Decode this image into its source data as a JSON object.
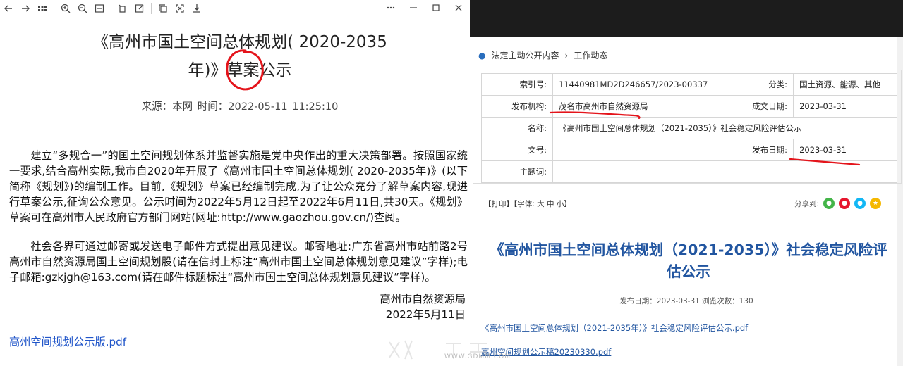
{
  "left": {
    "title_line1": "《高州市国土空间总体规划( 2020-2035",
    "title_line2": "年)》草案公示",
    "meta": "来源：本网    时间：2022-05-11 11:25:10",
    "para1": "建立“多规合一”的国土空间规划体系并监督实施是党中央作出的重大决策部署。按照国家统一要求,结合高州实际,我市自2020年开展了《高州市国土空间总体规划( 2020-2035年)》(以下简称《规划》)的编制工作。目前,《规划》草案已经编制完成,为了让公众充分了解草案内容,现进行草案公示,征询公众意见。公示时间为2022年5月12日起至2022年6月11日,共30天。《规划》草案可在高州市人民政府官方部门网站(网址:http://www.gaozhou.gov.cn/)查阅。",
    "para2": "社会各界可通过邮寄或发送电子邮件方式提出意见建议。邮寄地址:广东省高州市站前路2号高州市自然资源局国土空间规划股(请在信封上标注“高州市国土空间总体规划意见建议”字样);电子邮箱:gzkjgh@163.com(请在邮件标题标注“高州市国土空间总体规划意见建议”字样)。",
    "sign_org": "高州市自然资源局",
    "sign_date": "2022年5月11日",
    "attachment": "高州空间规划公示版.pdf"
  },
  "right": {
    "breadcrumb": [
      "法定主动公开内容",
      "工作动态"
    ],
    "info": {
      "index_label": "索引号:",
      "index_value": "11440981MD2D246657/2023-00337",
      "category_label": "分类:",
      "category_value": "国土资源、能源、其他",
      "org_label": "发布机构:",
      "org_value": "茂名市高州市自然资源局",
      "created_label": "成文日期:",
      "created_value": "2023-03-31",
      "name_label": "名称:",
      "name_value": "《高州市国土空间总体规划（2021-2035）》社会稳定风险评估公示",
      "docno_label": "文号:",
      "docno_value": "",
      "published_label": "发布日期:",
      "published_value": "2023-03-31",
      "subject_label": "主题词:",
      "subject_value": ""
    },
    "tools": "【打印】【字体: 大  中  小】",
    "share_label": "分享到:",
    "title": "《高州市国土空间总体规划（2021-2035）》社会稳定风险评估公示",
    "pub_info": "发布日期：2023-03-31   浏览次数：130",
    "link1": "《高州市国土空间总体规划（2021-2035年）》社会稳定风险评估公示.pdf",
    "link2": "高州空间规划公示稿20230330.pdf"
  },
  "watermark": "WWW.GDMM.COM",
  "colors": {
    "annotation_red": "#e4141b",
    "title_blue": "#2155a0",
    "link_blue": "#2156c9"
  }
}
